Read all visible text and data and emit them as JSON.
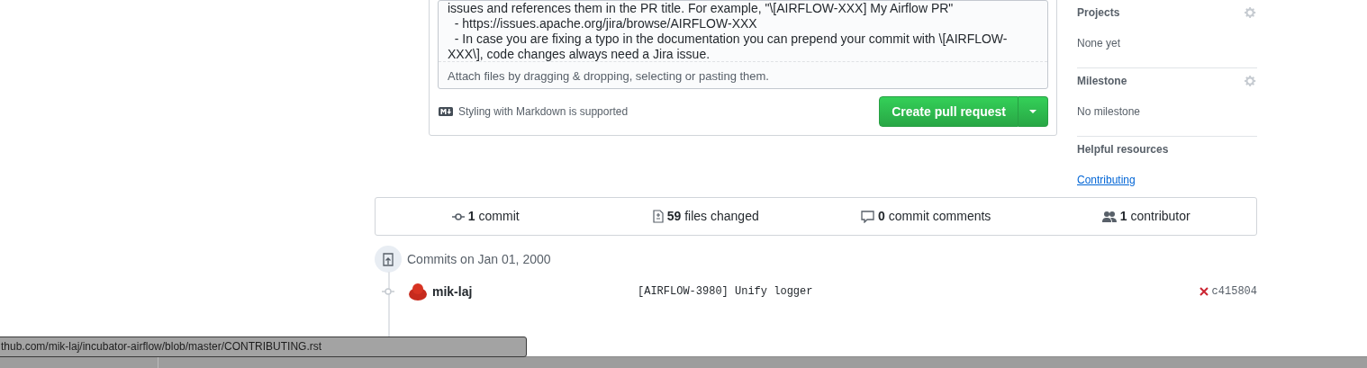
{
  "composer": {
    "body_lines": [
      "issues and references them in the PR title. For example, \"\\[AIRFLOW-XXX] My Airflow PR\"",
      "  - https://issues.apache.org/jira/browse/AIRFLOW-XXX",
      "  - In case you are fixing a typo in the documentation you can prepend your commit with \\[AIRFLOW-",
      "XXX\\], code changes always need a Jira issue."
    ],
    "attach_hint": "Attach files by dragging & dropping, selecting or pasting them.",
    "markdown_note": "Styling with Markdown is supported",
    "submit_button": "Create pull request"
  },
  "sidebar": [
    {
      "kind": "setting",
      "heading": "Projects",
      "value": "None yet"
    },
    {
      "kind": "setting",
      "heading": "Milestone",
      "value": "No milestone"
    },
    {
      "kind": "links",
      "heading": "Helpful resources",
      "value": "Contributing"
    }
  ],
  "stats": [
    {
      "kind": "commit",
      "count": "1",
      "label": "commit"
    },
    {
      "kind": "files",
      "count": "59",
      "label": "files changed"
    },
    {
      "kind": "comments",
      "count": "0",
      "label": "commit comments"
    },
    {
      "kind": "contributors",
      "count": "1",
      "label": "contributor"
    }
  ],
  "commit_group": {
    "date": "Commits on Jan 01, 2000",
    "commits": [
      {
        "author": "mik-laj",
        "message": "[AIRFLOW-3980] Unify logger",
        "failed": true,
        "sha": "c415804"
      }
    ]
  },
  "status_bar": {
    "url": "thub.com/mik-laj/incubator-airflow/blob/master/CONTRIBUTING.rst"
  }
}
